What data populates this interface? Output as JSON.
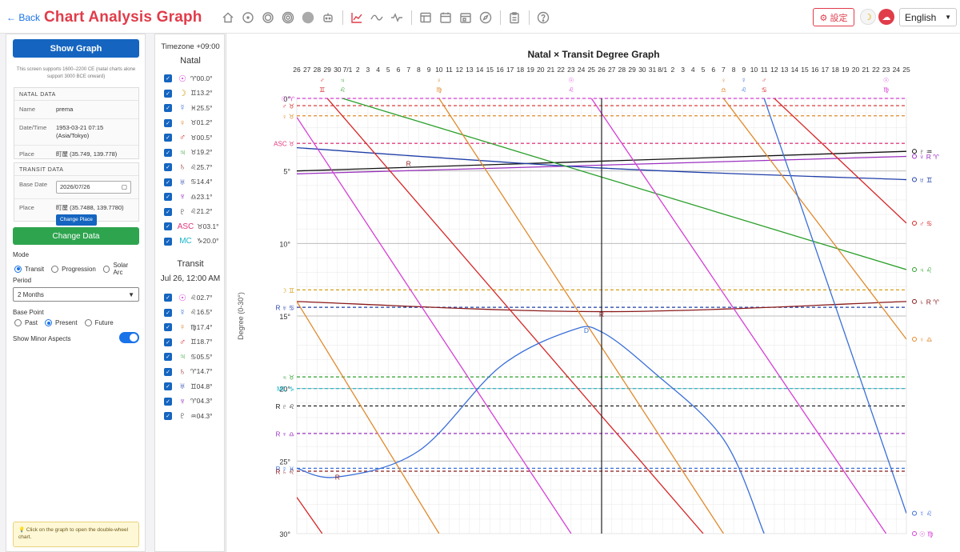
{
  "header": {
    "back_label": "← Back",
    "title": "Chart Analysis Graph",
    "toolbar_icons": [
      "home-icon",
      "circle-dot-icon",
      "double-circle-icon",
      "concentric-circle-icon",
      "filled-circle-icon",
      "robot-icon",
      "line-chart-icon",
      "wave-icon",
      "pulse-icon",
      "grid-icon",
      "calendar-icon",
      "calendar-alt-icon",
      "compass-icon",
      "clipboard-icon",
      "help-icon"
    ],
    "settings_label": "⚙ 設定",
    "language": "English"
  },
  "sidebar": {
    "show_graph_label": "Show Graph",
    "support_note": "This screen supports 1600–2200 CE (natal charts alone support 3000 BCE onward)",
    "natal": {
      "heading": "NATAL DATA",
      "name_label": "Name",
      "name_value": "prema",
      "datetime_label": "Date/Time",
      "datetime_value": "1953-03-21 07:15 (Asia/Tokyo)",
      "place_label": "Place",
      "place_value": "町屋 (35.749, 139.778)"
    },
    "transit": {
      "heading": "TRANSIT DATA",
      "base_date_label": "Base Date",
      "base_date_value": "2026/07/26",
      "place_label": "Place",
      "place_value": "町屋 (35.7488, 139.7780)",
      "change_place_label": "Change Place"
    },
    "change_data_label": "Change Data",
    "mode_label": "Mode",
    "modes": [
      {
        "label": "Transit",
        "selected": true
      },
      {
        "label": "Progression",
        "selected": false
      },
      {
        "label": "Solar Arc",
        "selected": false
      }
    ],
    "period_label": "Period",
    "period_value": "2 Months",
    "base_point_label": "Base Point",
    "base_points": [
      {
        "label": "Past",
        "selected": false
      },
      {
        "label": "Present",
        "selected": true
      },
      {
        "label": "Future",
        "selected": false
      }
    ],
    "minor_aspects_label": "Show Minor Aspects",
    "minor_aspects_on": true,
    "tip": "💡 Click on the graph to open the double-wheel chart."
  },
  "planet_panel": {
    "timezone": "Timezone +09:00",
    "natal_heading": "Natal",
    "natal": [
      {
        "sym": "☉",
        "val": "♈00.0°",
        "color": "#d63fd6"
      },
      {
        "sym": "☽",
        "val": "♊13.2°",
        "color": "#d4a017"
      },
      {
        "sym": "☿",
        "val": "♓25.5°",
        "color": "#3a6fd8"
      },
      {
        "sym": "♀",
        "val": "♉01.2°",
        "color": "#e08a2c"
      },
      {
        "sym": "♂",
        "val": "♉00.5°",
        "color": "#d62728"
      },
      {
        "sym": "♃",
        "val": "♉19.2°",
        "color": "#2ca02c"
      },
      {
        "sym": "♄",
        "val": "♌25.7°",
        "color": "#8b1a1a"
      },
      {
        "sym": "♅",
        "val": "♋14.4°",
        "color": "#1f3fa8"
      },
      {
        "sym": "♆",
        "val": "♎23.1°",
        "color": "#9b30c0"
      },
      {
        "sym": "♇",
        "val": "♌21.2°",
        "color": "#111111"
      },
      {
        "sym": "ASC",
        "val": "♉03.1°",
        "color": "#e0357a"
      },
      {
        "sym": "MC",
        "val": "♑20.0°",
        "color": "#17b5c9"
      }
    ],
    "transit_heading": "Transit",
    "transit_time": "Jul 26, 12:00 AM",
    "transit": [
      {
        "sym": "☉",
        "val": "♌02.7°",
        "color": "#d63fd6"
      },
      {
        "sym": "☿",
        "val": "♌16.5°",
        "color": "#3a6fd8"
      },
      {
        "sym": "♀",
        "val": "♍17.4°",
        "color": "#e08a2c"
      },
      {
        "sym": "♂",
        "val": "♊18.7°",
        "color": "#d62728"
      },
      {
        "sym": "♃",
        "val": "♋05.5°",
        "color": "#2ca02c"
      },
      {
        "sym": "♄",
        "val": "♈14.7°",
        "color": "#8b1a1a"
      },
      {
        "sym": "♅",
        "val": "♊04.8°",
        "color": "#1f3fa8"
      },
      {
        "sym": "♆",
        "val": "♈04.3°",
        "color": "#9b30c0"
      },
      {
        "sym": "♇",
        "val": "♒04.3°",
        "color": "#111111"
      }
    ]
  },
  "chart_data": {
    "type": "line",
    "title": "Natal × Transit Degree Graph",
    "ylabel": "Degree (0-30°)",
    "ylim": [
      0,
      30
    ],
    "y_ticks": [
      "0°",
      "5°",
      "10°",
      "15°",
      "20°",
      "25°",
      "30°"
    ],
    "x_ticks": [
      "26",
      "27",
      "28",
      "29",
      "30",
      "7/1",
      "2",
      "3",
      "4",
      "5",
      "6",
      "7",
      "8",
      "9",
      "10",
      "11",
      "12",
      "13",
      "14",
      "15",
      "16",
      "17",
      "18",
      "19",
      "20",
      "21",
      "22",
      "23",
      "24",
      "25",
      "26",
      "27",
      "28",
      "29",
      "30",
      "31",
      "8/1",
      "2",
      "3",
      "4",
      "5",
      "6",
      "7",
      "8",
      "9",
      "10",
      "11",
      "12",
      "13",
      "14",
      "15",
      "16",
      "17",
      "18",
      "19",
      "20",
      "21",
      "22",
      "23",
      "24",
      "25"
    ],
    "x_range_days": [
      0,
      60
    ],
    "current_day": 30,
    "natal_lines": [
      {
        "label": "☉ ♈",
        "y": 0.0,
        "color": "#d63fd6"
      },
      {
        "label": "♂ ♉",
        "y": 0.5,
        "color": "#d62728"
      },
      {
        "label": "♀ ♉",
        "y": 1.2,
        "color": "#e08a2c"
      },
      {
        "label": "ASC ♉",
        "y": 3.1,
        "color": "#e0357a"
      },
      {
        "label": "☽ ♊",
        "y": 13.2,
        "color": "#d4a017"
      },
      {
        "label": "R ♅ ♋",
        "y": 14.4,
        "color": "#1f3fa8"
      },
      {
        "label": "♃ ♉",
        "y": 19.2,
        "color": "#2ca02c"
      },
      {
        "label": "MC ♑",
        "y": 20.0,
        "color": "#17b5c9"
      },
      {
        "label": "R ♇ ♌",
        "y": 21.2,
        "color": "#111111"
      },
      {
        "label": "R ♆ ♎",
        "y": 23.1,
        "color": "#9b30c0"
      },
      {
        "label": "R ☿ ♓",
        "y": 25.5,
        "color": "#3a6fd8"
      },
      {
        "label": "R ♄ ♌",
        "y": 25.7,
        "color": "#8b1a1a"
      }
    ],
    "transit_series": [
      {
        "color": "#111111",
        "segments": [
          [
            [
              0,
              5.0
            ],
            [
              60,
              3.65
            ]
          ]
        ],
        "end_label": "♇ ♒"
      },
      {
        "color": "#9b30c0",
        "segments": [
          [
            [
              0,
              5.2
            ],
            [
              60,
              4.0
            ]
          ]
        ],
        "end_label": "♆ R ♈"
      },
      {
        "color": "#1f3fa8",
        "segments": [
          [
            [
              0,
              3.4
            ],
            [
              30,
              4.8
            ],
            [
              60,
              5.6
            ]
          ]
        ],
        "end_label": "♅ ♊"
      },
      {
        "color": "#2ca02c",
        "segments": [
          [
            [
              4.5,
              0
            ],
            [
              60,
              11.8
            ]
          ]
        ],
        "end_label": "♃ ♌"
      },
      {
        "color": "#8b1a1a",
        "segments": [
          [
            [
              0,
              14.0
            ],
            [
              30,
              14.7
            ],
            [
              60,
              14.0
            ]
          ]
        ],
        "end_label": "♄ R ♈"
      },
      {
        "color": "#d62728",
        "segments": [
          [
            [
              3,
              0
            ],
            [
              40,
              30
            ]
          ],
          [
            [
              47,
              0
            ],
            [
              60,
              8.6
            ]
          ],
          [
            [
              0,
              27.5
            ],
            [
              2.5,
              30
            ]
          ]
        ],
        "end_label": "♂ ♋"
      },
      {
        "color": "#d63fd6",
        "segments": [
          [
            [
              0,
              1.3
            ],
            [
              27,
              30
            ]
          ],
          [
            [
              29,
              0
            ],
            [
              58,
              30
            ]
          ]
        ],
        "end_label": "☉ ♍"
      },
      {
        "color": "#e08a2c",
        "segments": [
          [
            [
              0,
              14.0
            ],
            [
              14,
              30
            ]
          ],
          [
            [
              14,
              0
            ],
            [
              42,
              30
            ]
          ],
          [
            [
              42,
              0
            ],
            [
              60,
              16.6
            ]
          ]
        ],
        "end_label": "♀ ♎"
      },
      {
        "color": "#3a6fd8",
        "segments": [
          [
            [
              0,
              25.5
            ],
            [
              4,
              26.1
            ],
            [
              12,
              24.3
            ],
            [
              20,
              18.5
            ],
            [
              27,
              16.0
            ],
            [
              30,
              16.1
            ],
            [
              35,
              18.8
            ],
            [
              42,
              23.5
            ],
            [
              46,
              30
            ]
          ],
          [
            [
              46,
              0
            ],
            [
              60,
              28.6
            ]
          ]
        ],
        "end_label": "☿ ♌"
      }
    ],
    "top_markers": [
      {
        "x": 2.5,
        "label": "♂ ♊",
        "color": "#d62728"
      },
      {
        "x": 4.5,
        "label": "♃ ♌",
        "color": "#2ca02c"
      },
      {
        "x": 14,
        "label": "♀ ♍",
        "color": "#e08a2c"
      },
      {
        "x": 27,
        "label": "☉ ♌",
        "color": "#d63fd6"
      },
      {
        "x": 42,
        "label": "♀ ♎",
        "color": "#e08a2c"
      },
      {
        "x": 44,
        "label": "☿ ♌",
        "color": "#3a6fd8"
      },
      {
        "x": 46,
        "label": "♂ ♋",
        "color": "#d62728"
      },
      {
        "x": 58,
        "label": "☉ ♍",
        "color": "#d63fd6"
      }
    ],
    "annotations": [
      {
        "x": 11,
        "y": 4.5,
        "text": "R",
        "color": "#8b1a1a"
      },
      {
        "x": 30,
        "y": 14.9,
        "text": "R",
        "color": "#8b1a1a"
      },
      {
        "x": 28.5,
        "y": 16.0,
        "text": "D",
        "color": "#3a6fd8"
      },
      {
        "x": 4,
        "y": 26.1,
        "text": "R",
        "color": "#8b1a1a"
      }
    ]
  }
}
